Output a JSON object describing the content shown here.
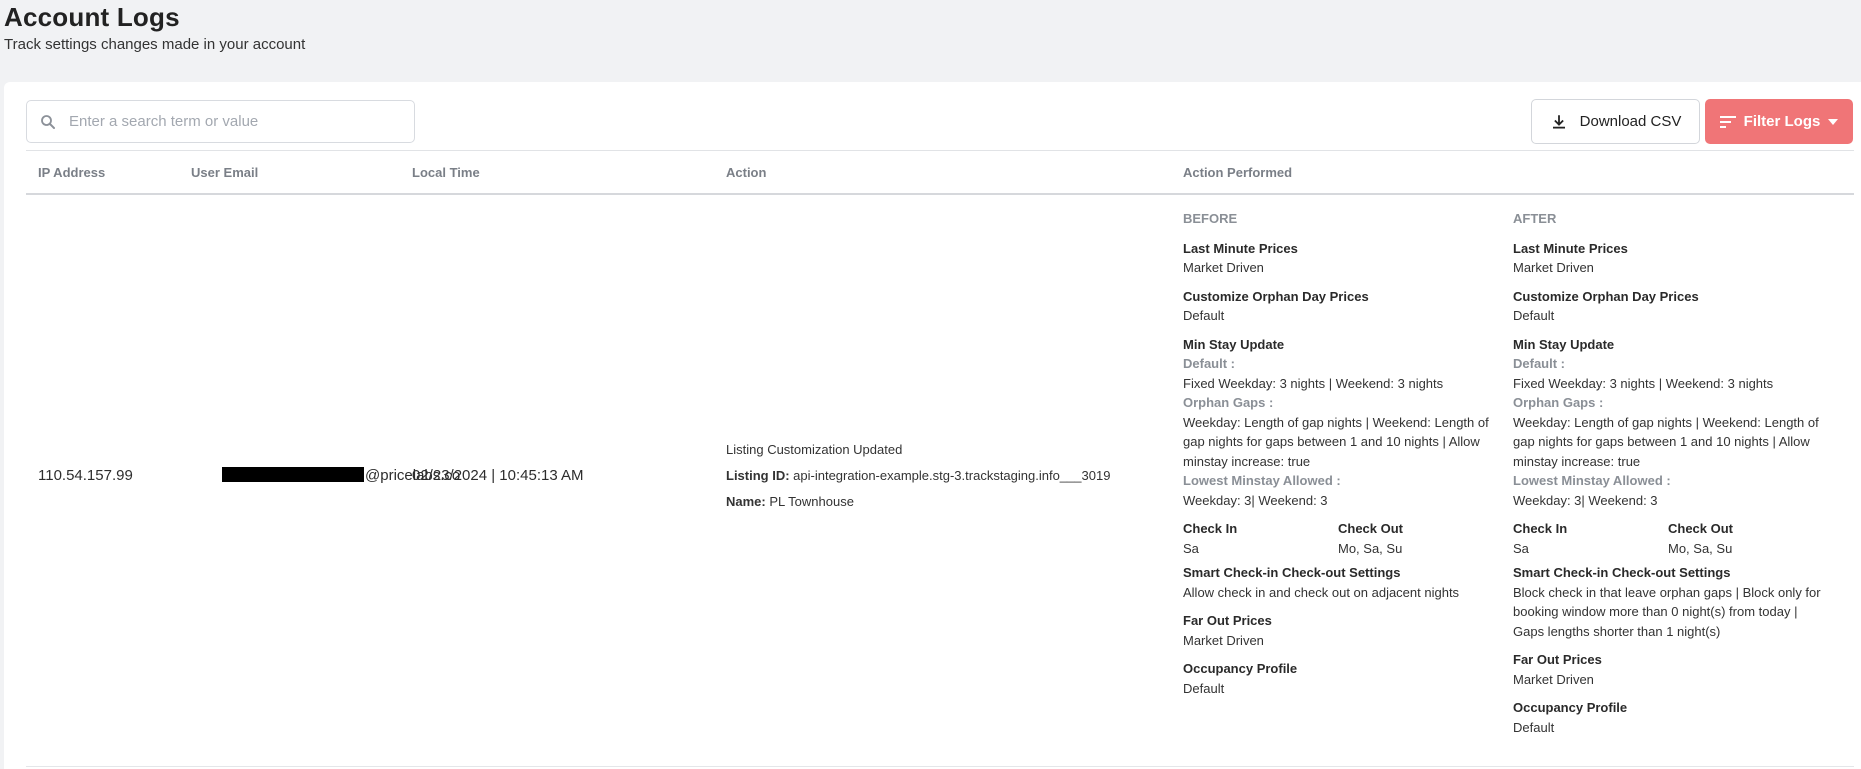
{
  "header": {
    "title": "Account Logs",
    "subtitle": "Track settings changes made in your account"
  },
  "toolbar": {
    "search_placeholder": "Enter a search term or value",
    "download_label": "Download CSV",
    "filter_label": "Filter Logs"
  },
  "table": {
    "columns": [
      "IP Address",
      "User Email",
      "Local Time",
      "Action",
      "Action Performed"
    ],
    "rows": [
      {
        "ip": "110.54.157.99",
        "email_suffix": "@pricelabs.co",
        "local_time": "02/23/2024 | 10:45:13 AM",
        "action": {
          "title": "Listing Customization Updated",
          "listing_id_label": "Listing ID:",
          "listing_id": "api-integration-example.stg-3.trackstaging.info___3019",
          "name_label": "Name:",
          "name": "PL Townhouse"
        },
        "before": {
          "heading": "BEFORE",
          "last_minute_label": "Last Minute Prices",
          "last_minute_value": "Market Driven",
          "orphan_label": "Customize Orphan Day Prices",
          "orphan_value": "Default",
          "minstay_label": "Min Stay Update",
          "default_label": "Default :",
          "default_value": "Fixed Weekday: 3 nights | Weekend: 3 nights",
          "orphan_gaps_label": "Orphan Gaps :",
          "orphan_gaps_value": "Weekday: Length of gap nights | Weekend: Length of gap nights for gaps between 1 and 10 nights | Allow minstay increase: true",
          "lowest_label": "Lowest Minstay Allowed :",
          "lowest_value": "Weekday: 3| Weekend: 3",
          "checkin_label": "Check In",
          "checkin_value": "Sa",
          "checkout_label": "Check Out",
          "checkout_value": "Mo, Sa, Su",
          "smart_label": "Smart Check-in Check-out Settings",
          "smart_value": "Allow check in and check out on adjacent nights",
          "farout_label": "Far Out Prices",
          "farout_value": "Market Driven",
          "occupancy_label": "Occupancy Profile",
          "occupancy_value": "Default"
        },
        "after": {
          "heading": "AFTER",
          "last_minute_label": "Last Minute Prices",
          "last_minute_value": "Market Driven",
          "orphan_label": "Customize Orphan Day Prices",
          "orphan_value": "Default",
          "minstay_label": "Min Stay Update",
          "default_label": "Default :",
          "default_value": "Fixed Weekday: 3 nights | Weekend: 3 nights",
          "orphan_gaps_label": "Orphan Gaps :",
          "orphan_gaps_value": "Weekday: Length of gap nights | Weekend: Length of gap nights for gaps between 1 and 10 nights | Allow minstay increase: true",
          "lowest_label": "Lowest Minstay Allowed :",
          "lowest_value": "Weekday: 3| Weekend: 3",
          "checkin_label": "Check In",
          "checkin_value": "Sa",
          "checkout_label": "Check Out",
          "checkout_value": "Mo, Sa, Su",
          "smart_label": "Smart Check-in Check-out Settings",
          "smart_value": "Block check in that leave orphan gaps | Block only for booking window more than 0 night(s) from today | Gaps lengths shorter than 1 night(s)",
          "farout_label": "Far Out Prices",
          "farout_value": "Market Driven",
          "occupancy_label": "Occupancy Profile",
          "occupancy_value": "Default"
        }
      }
    ]
  },
  "colors": {
    "page_bg": "#f1f2f4",
    "filter_button": "#f07577",
    "header_text": "#7a7f87"
  },
  "icons": {
    "search": "search-icon",
    "download": "download-icon",
    "filter": "filter-lines-icon",
    "dropdown": "caret-down-icon"
  }
}
